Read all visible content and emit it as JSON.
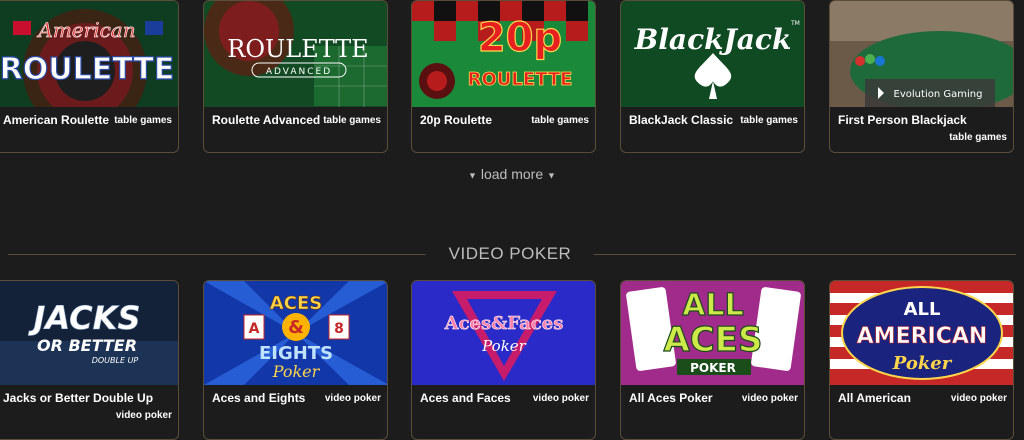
{
  "table_games": [
    {
      "name": "American Roulette",
      "category": "table games",
      "art": [
        "American",
        "ROULETTE"
      ]
    },
    {
      "name": "Roulette Advanced",
      "category": "table games",
      "art": [
        "ROULETTE",
        "ADVANCED"
      ]
    },
    {
      "name": "20p Roulette",
      "category": "table games",
      "art": [
        "20p",
        "ROULETTE"
      ]
    },
    {
      "name": "BlackJack Classic",
      "category": "table games",
      "art": [
        "BlackJack",
        "TM"
      ]
    },
    {
      "name": "First Person Blackjack",
      "category": "table games",
      "art": [
        "Evolution Gaming"
      ]
    }
  ],
  "load_more": {
    "label": "load more"
  },
  "video_poker_section": {
    "title": "VIDEO POKER"
  },
  "video_poker": [
    {
      "name": "Jacks or Better Double Up",
      "category": "video poker",
      "art": [
        "JACKS",
        "OR BETTER",
        "DOUBLE UP"
      ]
    },
    {
      "name": "Aces and Eights",
      "category": "video poker",
      "art": [
        "ACES",
        "A",
        "&",
        "8",
        "EIGHTS",
        "Poker"
      ]
    },
    {
      "name": "Aces and Faces",
      "category": "video poker",
      "art": [
        "Aces&Faces",
        "Poker"
      ]
    },
    {
      "name": "All Aces Poker",
      "category": "video poker",
      "art": [
        "ALL",
        "ACES",
        "POKER"
      ]
    },
    {
      "name": "All American",
      "category": "video poker",
      "art": [
        "ALL",
        "AMERICAN",
        "Poker"
      ]
    }
  ]
}
